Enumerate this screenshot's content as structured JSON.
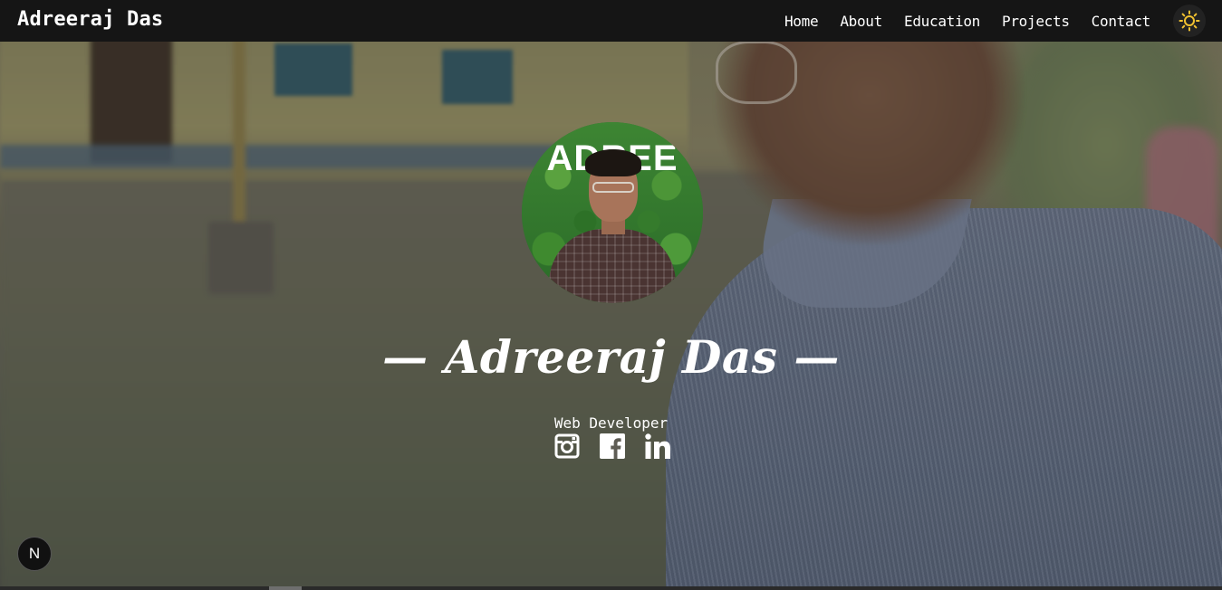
{
  "header": {
    "brand": "Adreeraj Das",
    "nav": [
      {
        "label": "Home"
      },
      {
        "label": "About"
      },
      {
        "label": "Education"
      },
      {
        "label": "Projects"
      },
      {
        "label": "Contact"
      }
    ],
    "theme_toggle_icon": "sun-icon",
    "accent": "#f2c230"
  },
  "hero": {
    "avatar_text": "ADREE",
    "name": "— Adreeraj Das —",
    "role": "Web Developer",
    "socials": [
      {
        "name": "instagram",
        "icon": "instagram-icon"
      },
      {
        "name": "facebook",
        "icon": "facebook-icon"
      },
      {
        "name": "linkedin",
        "icon": "linkedin-icon"
      }
    ]
  },
  "badge": {
    "label": "N"
  },
  "colors": {
    "navbar": "#151515",
    "text": "#ffffff"
  }
}
